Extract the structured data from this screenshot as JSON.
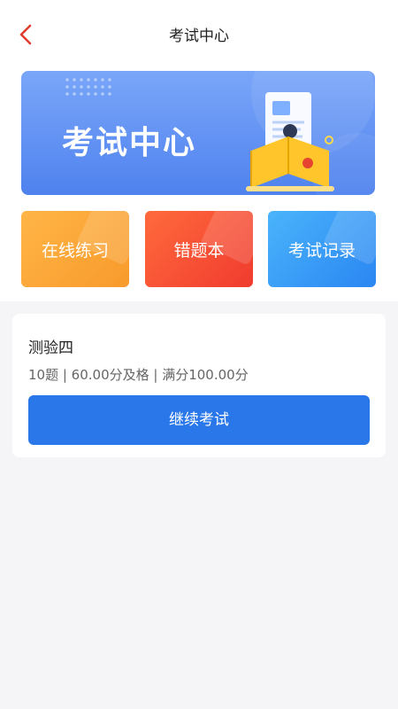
{
  "header": {
    "title": "考试中心",
    "back_icon": "chevron-left-icon",
    "accent_color": "#e03b30"
  },
  "banner": {
    "title": "考试中心",
    "icon": "exam-illustration"
  },
  "tiles": [
    {
      "label": "在线练习",
      "color": "#f9a23a"
    },
    {
      "label": "错题本",
      "color": "#f5473a"
    },
    {
      "label": "考试记录",
      "color": "#3a9cf5"
    }
  ],
  "exam": {
    "name": "测验四",
    "meta": "10题 | 60.00分及格 | 满分100.00分",
    "button_label": "继续考试",
    "button_color": "#2a77ea"
  }
}
